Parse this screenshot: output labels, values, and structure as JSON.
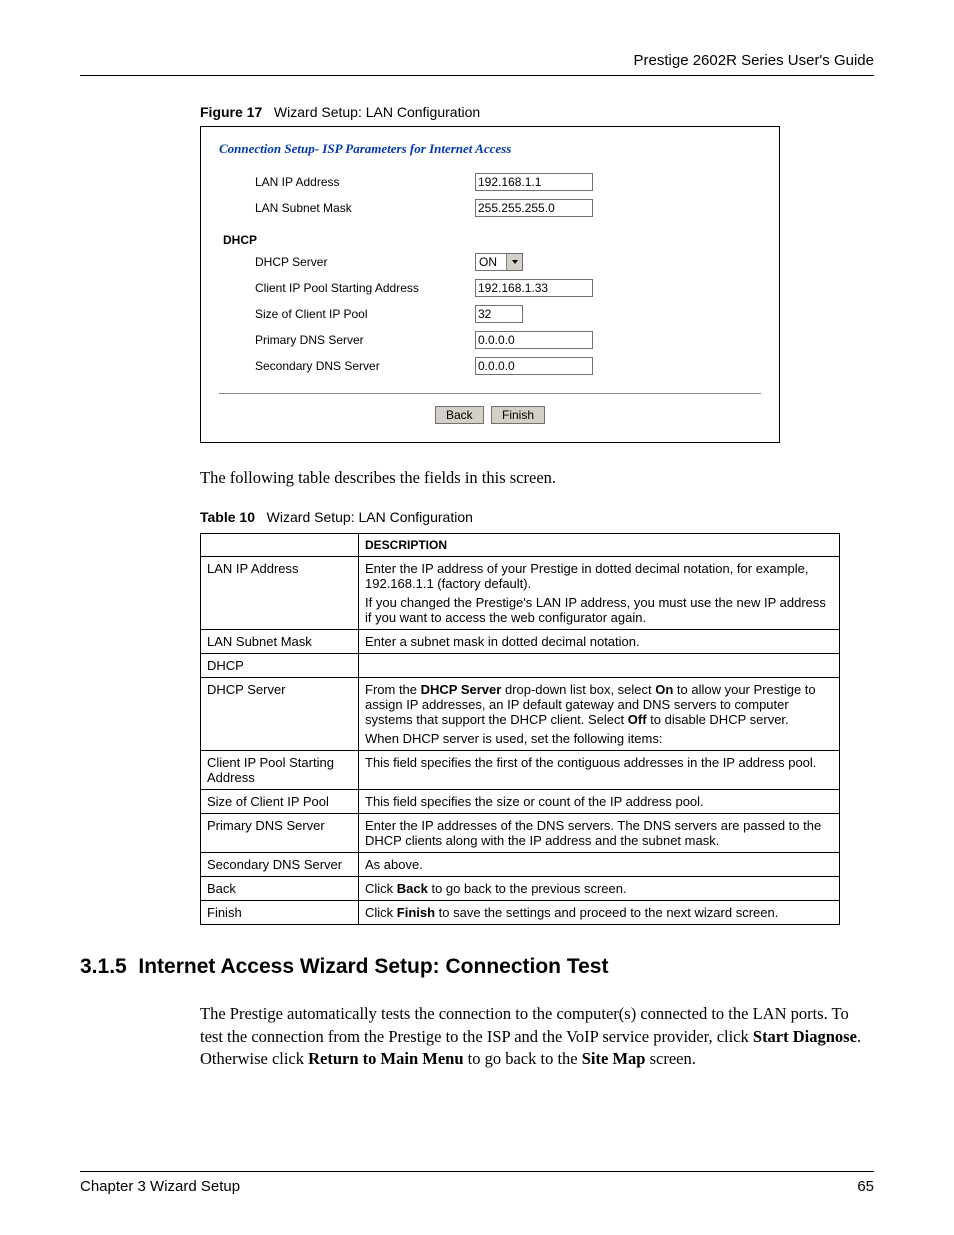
{
  "header": "Prestige 2602R Series User's Guide",
  "figure": {
    "label": "Figure 17",
    "title": "Wizard Setup: LAN Configuration",
    "panel_title": "Connection Setup- ISP Parameters for Internet Access",
    "fields": {
      "lan_ip_label": "LAN IP Address",
      "lan_ip_value": "192.168.1.1",
      "lan_mask_label": "LAN Subnet Mask",
      "lan_mask_value": "255.255.255.0",
      "dhcp_heading": "DHCP",
      "dhcp_server_label": "DHCP Server",
      "dhcp_server_value": "ON",
      "pool_start_label": "Client IP Pool Starting Address",
      "pool_start_value": "192.168.1.33",
      "pool_size_label": "Size of Client IP Pool",
      "pool_size_value": "32",
      "pri_dns_label": "Primary DNS Server",
      "pri_dns_value": "0.0.0.0",
      "sec_dns_label": "Secondary DNS Server",
      "sec_dns_value": "0.0.0.0",
      "back_btn": "Back",
      "finish_btn": "Finish"
    }
  },
  "lead_text": "The following table describes the fields in this screen.",
  "table": {
    "label": "Table 10",
    "title": "Wizard Setup: LAN Configuration",
    "col1": "",
    "col2": "DESCRIPTION",
    "rows": [
      {
        "label": "LAN IP Address",
        "desc_html": "<p>Enter the IP address of your Prestige in dotted decimal notation, for example, 192.168.1.1 (factory default).</p><p>If you changed the Prestige's LAN IP address, you must use the new IP address if you want to access the web configurator again.</p>"
      },
      {
        "label": "LAN Subnet Mask",
        "desc_html": "Enter a subnet mask in dotted decimal notation."
      },
      {
        "label": "DHCP",
        "desc_html": ""
      },
      {
        "label": "DHCP Server",
        "desc_html": "<p>From the <b>DHCP Server</b> drop-down list box, select <b>On</b> to allow your Prestige to assign IP addresses, an IP default gateway and DNS servers to computer systems that support the DHCP client. Select <b>Off</b> to disable DHCP server.</p><p>When DHCP server is used, set the following items:</p>"
      },
      {
        "label": "Client IP Pool Starting Address",
        "desc_html": "This field specifies the first of the contiguous addresses in the IP address pool."
      },
      {
        "label": "Size of Client IP Pool",
        "desc_html": "This field specifies the size or count of the IP address pool."
      },
      {
        "label": "Primary DNS Server",
        "desc_html": "Enter the IP addresses of the DNS servers. The DNS servers are passed to the DHCP clients along with the IP address and the subnet mask."
      },
      {
        "label": "Secondary DNS Server",
        "desc_html": "As above."
      },
      {
        "label": "Back",
        "desc_html": "Click <b>Back</b> to go back to the previous screen."
      },
      {
        "label": "Finish",
        "desc_html": "Click <b>Finish</b> to save the settings and proceed to the next wizard screen."
      }
    ]
  },
  "section": {
    "number": "3.1.5",
    "title": "Internet Access Wizard Setup: Connection Test",
    "body_html": "The Prestige automatically tests the connection to the computer(s) connected to the LAN ports. To test the connection from the Prestige to the ISP and the VoIP service provider, click <b>Start Diagnose</b>. Otherwise click <b>Return to Main Menu</b> to go back to the <b>Site Map</b> screen."
  },
  "footer": {
    "left": "Chapter 3 Wizard Setup",
    "right": "65"
  }
}
